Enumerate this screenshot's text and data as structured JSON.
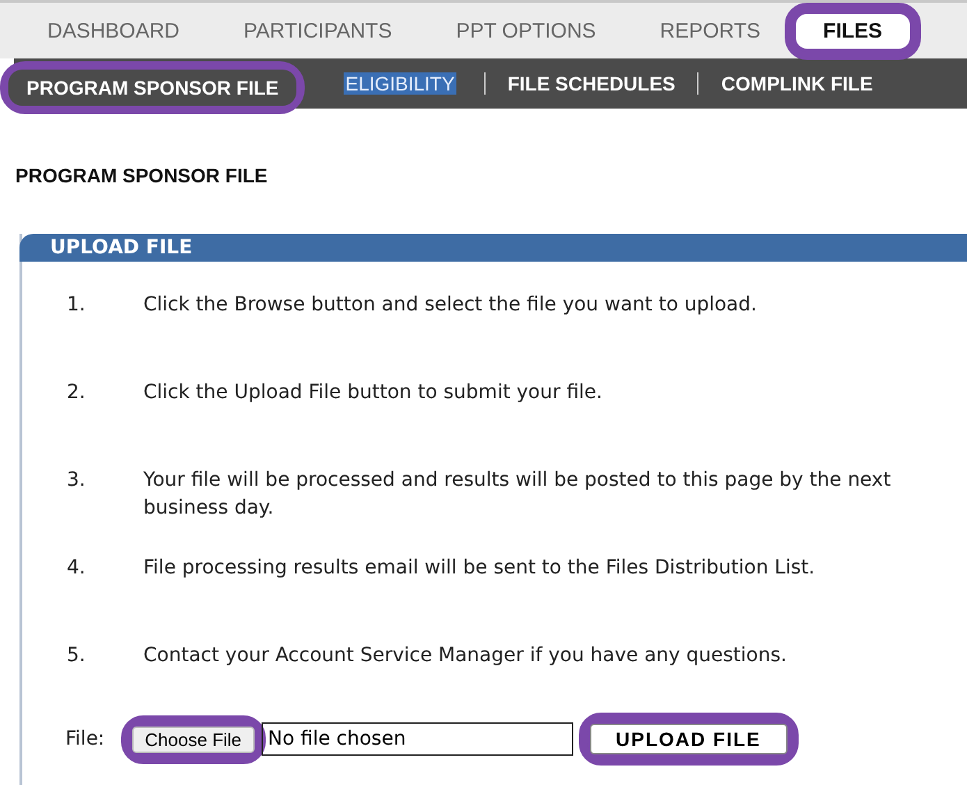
{
  "tabs": [
    {
      "label": "DASHBOARD",
      "selected": false,
      "highlighted": false
    },
    {
      "label": "PARTICIPANTS",
      "selected": false,
      "highlighted": false
    },
    {
      "label": "PPT OPTIONS",
      "selected": false,
      "highlighted": false
    },
    {
      "label": "REPORTS",
      "selected": false,
      "highlighted": false
    },
    {
      "label": "FILES",
      "selected": true,
      "highlighted": true
    }
  ],
  "subnav": [
    {
      "label": "PROGRAM SPONSOR FILE",
      "selected": true,
      "highlighted": true,
      "text_selected": false
    },
    {
      "label": "ELIGIBILITY",
      "selected": false,
      "highlighted": false,
      "text_selected": true
    },
    {
      "label": "FILE SCHEDULES",
      "selected": false,
      "highlighted": false,
      "text_selected": false
    },
    {
      "label": "COMPLINK FILE",
      "selected": false,
      "highlighted": false,
      "text_selected": false
    }
  ],
  "page_title": "PROGRAM SPONSOR FILE",
  "panel": {
    "title": "UPLOAD FILE",
    "steps": [
      {
        "number": "1.",
        "text": "Click the Browse button and select the file you want to upload."
      },
      {
        "number": "2.",
        "text": "Click the Upload File button to submit your file."
      },
      {
        "number": "3.",
        "text": "Your file will be processed and results will be posted to this page by the next business day."
      },
      {
        "number": "4.",
        "text": "File processing results email will be sent to the Files Distribution List."
      },
      {
        "number": "5.",
        "text": "Contact your Account Service Manager if you have any questions."
      }
    ],
    "file_label": "File:",
    "choose_button": {
      "label": "Choose File",
      "highlighted": true
    },
    "file_status": "No file chosen",
    "upload_button": {
      "label": "UPLOAD FILE",
      "highlighted": true
    }
  }
}
